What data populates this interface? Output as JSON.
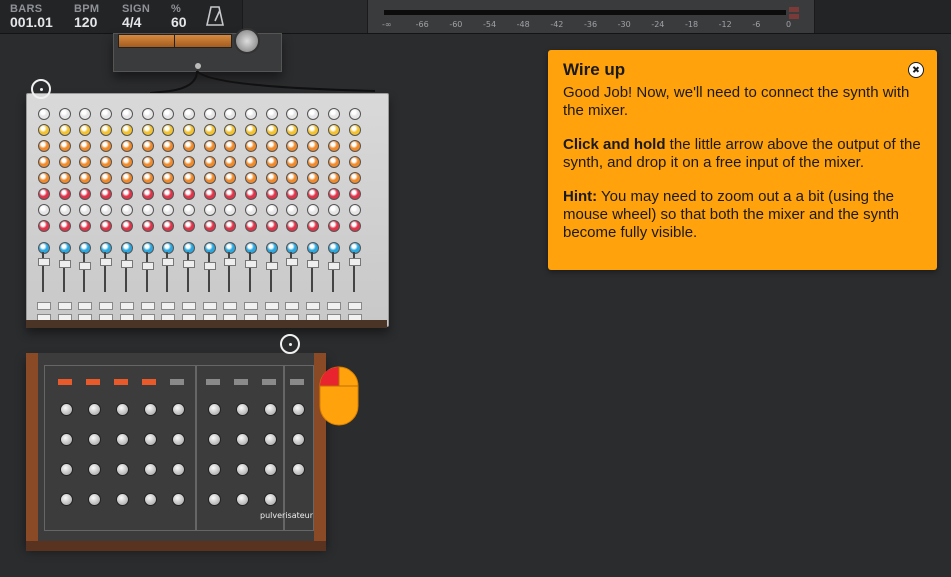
{
  "transport": {
    "bars": {
      "label": "BARS",
      "value": "001.01"
    },
    "bpm": {
      "label": "BPM",
      "value": "120"
    },
    "sign": {
      "label": "SIGN",
      "value": "4/4"
    },
    "percent": {
      "label": "%",
      "value": "60"
    },
    "metronome_icon": "metronome-icon"
  },
  "meter": {
    "ticks": [
      "-∞",
      "-66",
      "-60",
      "-54",
      "-48",
      "-42",
      "-36",
      "-30",
      "-24",
      "-18",
      "-12",
      "-6",
      "0"
    ]
  },
  "tutorial": {
    "title": "Wire up",
    "p1": "Good Job! Now, we'll need to connect the synth with the mixer.",
    "p2_bold": "Click and hold",
    "p2_rest": " the little arrow above the output of the synth, and drop it on a free input of the mixer.",
    "p3_bold": "Hint:",
    "p3_rest": " You may need to zoom out a a bit (using the mouse wheel) so that both the mixer and the synth become fully visible.",
    "close_icon": "close-icon"
  },
  "synth": {
    "logo": "pulverisateur"
  },
  "colors": {
    "card": "#ffa20b",
    "background": "#2b2c2e",
    "mixer_panel": "#d2d2d2",
    "synth_wood": "#8a4a26",
    "knob_yellow": "#f2c230",
    "knob_orange": "#f08a2a",
    "knob_red": "#e0344a",
    "knob_blue": "#2aa8e0"
  }
}
